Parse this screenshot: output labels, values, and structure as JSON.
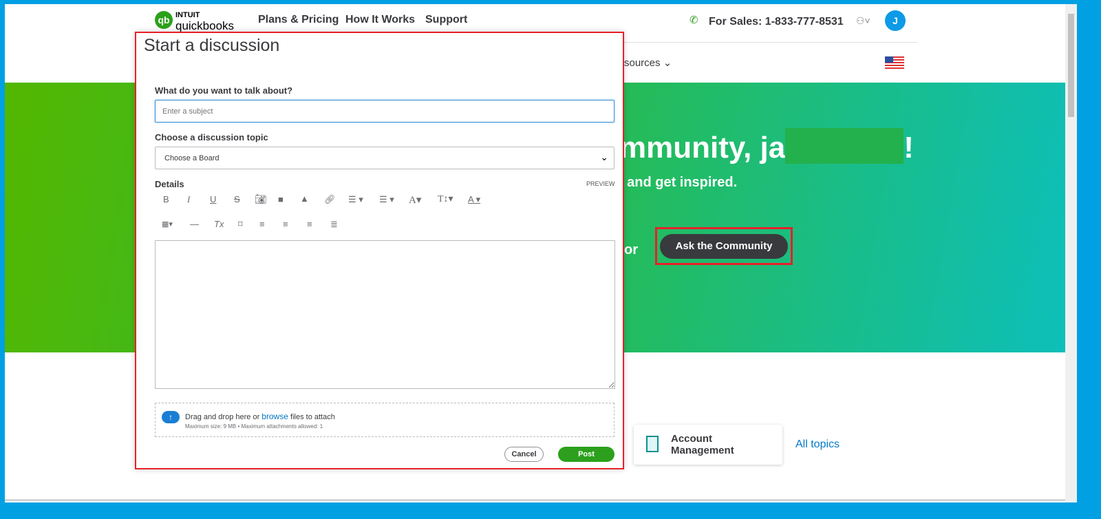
{
  "header": {
    "logo_top": "INTUIT",
    "logo_bottom": "quickbooks",
    "nav": [
      "Plans & Pricing",
      "How It Works",
      "Support"
    ],
    "sales": "For Sales: 1-833-777-8531",
    "avatar": "J",
    "resources": "sources"
  },
  "hero": {
    "title": "mmunity, ja",
    "title_end": "!",
    "subtitle": ", and get inspired.",
    "or": "or",
    "ask_button": "Ask the Community"
  },
  "topics": {
    "card": "Account Management",
    "all": "All topics"
  },
  "modal": {
    "title": "Start a discussion",
    "subject_label": "What do you want to talk about?",
    "subject_placeholder": "Enter a subject",
    "topic_label": "Choose a discussion topic",
    "topic_value": "Choose a Board",
    "details_label": "Details",
    "preview": "PREVIEW",
    "toolbar1": [
      "B",
      "I",
      "U",
      "S",
      "camera",
      "video",
      "warning",
      "link",
      "ol",
      "ul",
      "A",
      "TI",
      "A"
    ],
    "toolbar2": [
      "table",
      "hr",
      "Tx",
      "bookmark",
      "left",
      "center",
      "right",
      "justify"
    ],
    "attach_pre": "Drag and drop here or ",
    "attach_link": "browse",
    "attach_post": " files to attach",
    "attach_limits": "Maximum size: 9 MB • Maximum attachments allowed: 1",
    "cancel": "Cancel",
    "post": "Post"
  },
  "colors": {
    "accent_green": "#2ca01c",
    "blue": "#0077c5",
    "red": "#e8202a"
  }
}
